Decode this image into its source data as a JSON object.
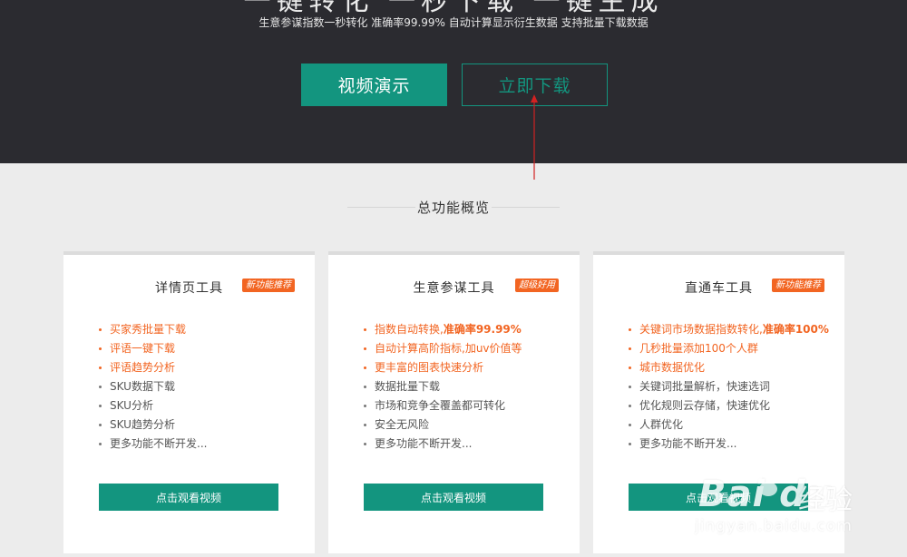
{
  "hero": {
    "title_clipped": "一键转化 一秒下载 一键生成",
    "subtitle": "生意参谋指数一秒转化 准确率99.99% 自动计算显示衍生数据 支持批量下载数据",
    "demo_button": "视频演示",
    "download_button": "立即下载"
  },
  "colors": {
    "accent": "#13957f",
    "highlight": "#f26522",
    "annotation_arrow": "#d22222",
    "hero_bg": "#2b2b30"
  },
  "section": {
    "title": "总功能概览"
  },
  "cards": [
    {
      "title": "详情页工具",
      "badge": "新功能推荐",
      "features": [
        {
          "text": "买家秀批量下载",
          "em": ""
        },
        {
          "text": "评语一键下载",
          "em": ""
        },
        {
          "text": "评语趋势分析",
          "em": ""
        },
        {
          "text": "SKU数据下载",
          "em": ""
        },
        {
          "text": "SKU分析",
          "em": ""
        },
        {
          "text": "SKU趋势分析",
          "em": ""
        },
        {
          "text": "更多功能不断开发...",
          "em": ""
        }
      ],
      "button": "点击观看视频"
    },
    {
      "title": "生意参谋工具",
      "badge": "超级好用",
      "features": [
        {
          "text": "指数自动转换,",
          "em": "准确率99.99%"
        },
        {
          "text": "自动计算高阶指标,加uv价值等",
          "em": ""
        },
        {
          "text": "更丰富的图表快速分析",
          "em": ""
        },
        {
          "text": "数据批量下载",
          "em": ""
        },
        {
          "text": "市场和竞争全覆盖都可转化",
          "em": ""
        },
        {
          "text": "安全无风险",
          "em": ""
        },
        {
          "text": "更多功能不断开发...",
          "em": ""
        }
      ],
      "button": "点击观看视频"
    },
    {
      "title": "直通车工具",
      "badge": "新功能推荐",
      "features": [
        {
          "text": "关键词市场数据指数转化,",
          "em": "准确率100%"
        },
        {
          "text": "几秒批量添加100个人群",
          "em": ""
        },
        {
          "text": "城市数据优化",
          "em": ""
        },
        {
          "text": "关键词批量解析，快速选词",
          "em": ""
        },
        {
          "text": "优化规则云存储，快速优化",
          "em": ""
        },
        {
          "text": "人群优化",
          "em": ""
        },
        {
          "text": "更多功能不断开发...",
          "em": ""
        }
      ],
      "button": "点击观看视频"
    }
  ],
  "watermark": {
    "logo_text": "Bai du",
    "logo_cn": "经验",
    "url": "jingyan.baidu.com"
  }
}
